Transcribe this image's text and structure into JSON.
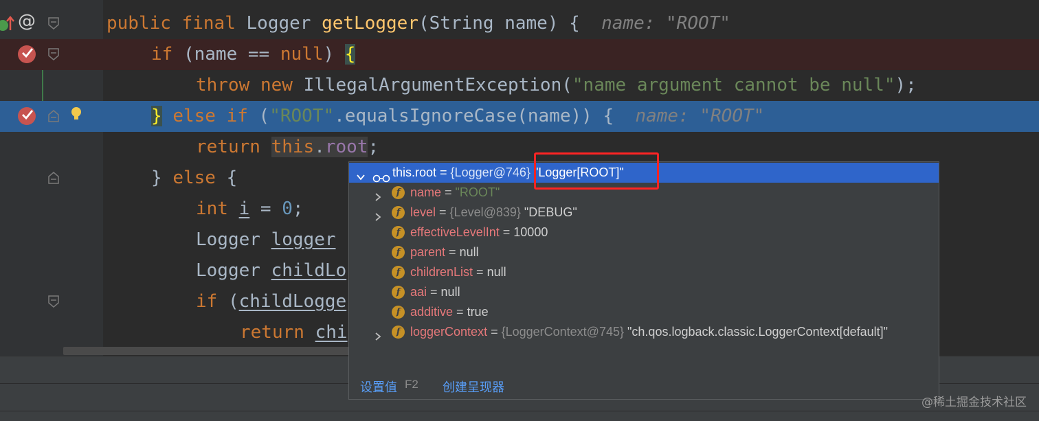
{
  "code_lines": {
    "l1": {
      "mod1": "public",
      "mod2": "final",
      "type": "Logger",
      "method": "getLogger",
      "params": "(String name) {",
      "hint": "name: \"ROOT\""
    },
    "l2": {
      "kw": "if",
      "cond_a": " (name == ",
      "null_kw": "null",
      "cond_b": ") ",
      "brace": "{"
    },
    "l3": {
      "kw1": "throw",
      "kw2": "new",
      "cls": "IllegalArgumentException(",
      "str": "\"name argument cannot be null\"",
      "tail": ");"
    },
    "l4": {
      "brace": "}",
      "kw_else": "else",
      "kw_if": "if",
      "paren": " (",
      "str": "\"ROOT\"",
      "call": ".equalsIgnoreCase(name)) {",
      "hint": "name: \"ROOT\""
    },
    "l5": {
      "kw": "return",
      "this_kw": "this",
      "dot": ".",
      "field": "root",
      "semi": ";"
    },
    "l6": {
      "close": "}",
      "kw": "else",
      "open": "{"
    },
    "l7": {
      "kw": "int",
      "var": "i",
      "eq": " = ",
      "num": "0",
      "semi": ";"
    },
    "l8": {
      "type": "Logger",
      "var": "logger"
    },
    "l9": {
      "type": "Logger",
      "var": "childLo"
    },
    "l10": {
      "kw": "if",
      "paren": " (",
      "var": "childLogge"
    },
    "l11": {
      "kw": "return",
      "var": "chi"
    }
  },
  "gutter": {
    "at_symbol": "@"
  },
  "debug_popup": {
    "root": {
      "name": "this.root",
      "eq": " = ",
      "ref": "{Logger@746}",
      "value": "\"Logger[ROOT]\""
    },
    "fields": [
      {
        "name": "name",
        "eq": " = ",
        "ref": "",
        "value": "\"ROOT\"",
        "value_kind": "string",
        "expandable": true
      },
      {
        "name": "level",
        "eq": " = ",
        "ref": "{Level@839}",
        "value": "\"DEBUG\"",
        "value_kind": "plain",
        "expandable": true
      },
      {
        "name": "effectiveLevelInt",
        "eq": " = ",
        "ref": "",
        "value": "10000",
        "value_kind": "plain",
        "expandable": false
      },
      {
        "name": "parent",
        "eq": " = ",
        "ref": "",
        "value": "null",
        "value_kind": "plain",
        "expandable": false
      },
      {
        "name": "childrenList",
        "eq": " = ",
        "ref": "",
        "value": "null",
        "value_kind": "plain",
        "expandable": false
      },
      {
        "name": "aai",
        "eq": " = ",
        "ref": "",
        "value": "null",
        "value_kind": "plain",
        "expandable": false
      },
      {
        "name": "additive",
        "eq": " = ",
        "ref": "",
        "value": "true",
        "value_kind": "plain",
        "expandable": false
      },
      {
        "name": "loggerContext",
        "eq": " = ",
        "ref": "{LoggerContext@745}",
        "value": "\"ch.qos.logback.classic.LoggerContext[default]\"",
        "value_kind": "plain",
        "expandable": true
      }
    ],
    "field_icon_letter": "f",
    "footer": {
      "set_value": "设置值",
      "set_value_key": "F2",
      "create_renderer": "创建呈现器"
    }
  },
  "watermark": "@稀土掘金技术社区",
  "colors": {
    "keyword": "#cc7832",
    "string": "#6a8759",
    "selected_row": "#2f65ca",
    "breakpoint": "#c75450",
    "highlight_box": "#ff2424"
  }
}
